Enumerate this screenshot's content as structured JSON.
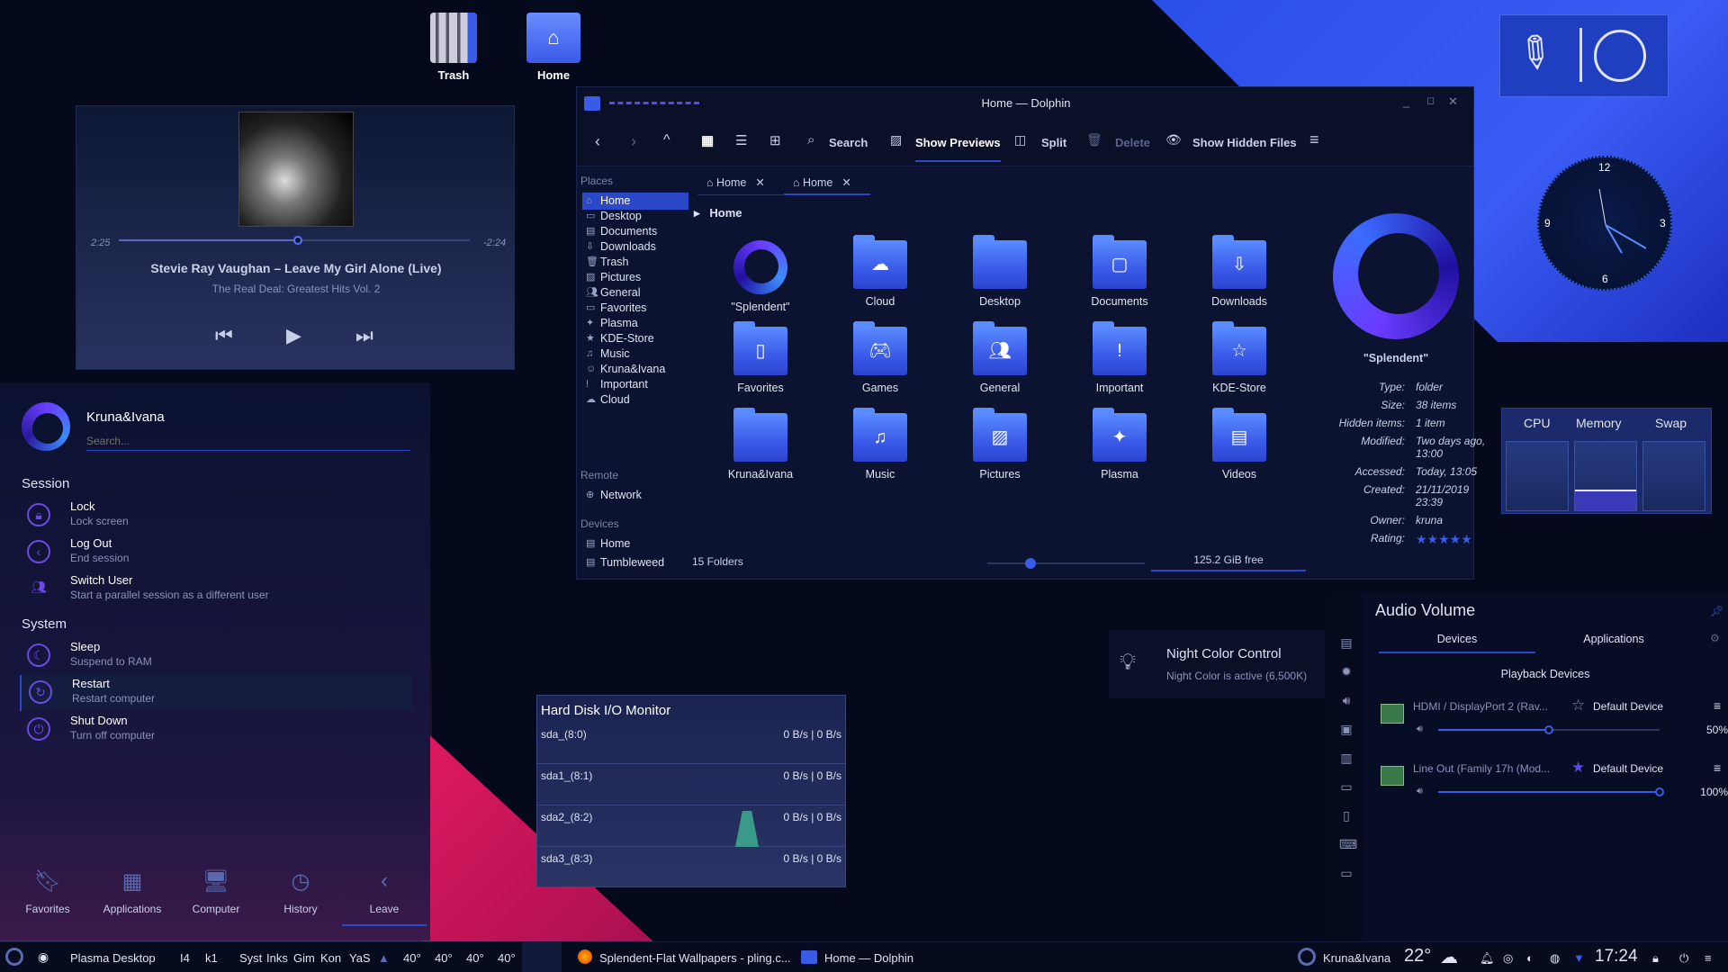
{
  "colors": {
    "accent": "#2a48c8",
    "brand": "#5a73ff",
    "pink": "#e0195f"
  },
  "desktop": {
    "icons": [
      {
        "label": "Trash",
        "icon": "trash-icon"
      },
      {
        "label": "Home",
        "icon": "home-folder-icon"
      }
    ]
  },
  "player": {
    "elapsed": "2:25",
    "remaining": "-2:24",
    "progress": 0.51,
    "title": "Stevie Ray Vaughan – Leave My Girl Alone (Live)",
    "album": "The Real Deal: Greatest Hits Vol. 2"
  },
  "launcher": {
    "user": "Kruna&Ivana",
    "search_placeholder": "Search...",
    "session_title": "Session",
    "session": [
      {
        "t": "Lock",
        "s": "Lock screen"
      },
      {
        "t": "Log Out",
        "s": "End session"
      },
      {
        "t": "Switch User",
        "s": "Start a parallel session as a different user"
      }
    ],
    "system_title": "System",
    "system": [
      {
        "t": "Sleep",
        "s": "Suspend to RAM"
      },
      {
        "t": "Restart",
        "s": "Restart computer"
      },
      {
        "t": "Shut Down",
        "s": "Turn off computer"
      }
    ],
    "tabs": [
      "Favorites",
      "Applications",
      "Computer",
      "History",
      "Leave"
    ]
  },
  "dolphin": {
    "title": "Home — Dolphin",
    "toolbar": {
      "search": "Search",
      "previews": "Show Previews",
      "split": "Split",
      "delete": "Delete",
      "hidden": "Show Hidden Files"
    },
    "tabs": [
      "Home",
      "Home"
    ],
    "breadcrumb": "Home",
    "places_head": "Places",
    "places": [
      "Home",
      "Desktop",
      "Documents",
      "Downloads",
      "Trash",
      "Pictures",
      "General",
      "Favorites",
      "Plasma",
      "KDE-Store",
      "Music",
      "Kruna&Ivana",
      "Important",
      "Cloud"
    ],
    "remote_head": "Remote",
    "remote": [
      "Network"
    ],
    "devices_head": "Devices",
    "devices": [
      "Home",
      "Tumbleweed"
    ],
    "folders": [
      "\"Splendent\"",
      "Cloud",
      "Desktop",
      "Documents",
      "Downloads",
      "Favorites",
      "Games",
      "General",
      "Important",
      "KDE-Store",
      "Kruna&Ivana",
      "Music",
      "Pictures",
      "Plasma",
      "Videos"
    ],
    "status": "15 Folders",
    "free": "125.2 GiB free",
    "info": {
      "name": "\"Splendent\"",
      "rows": [
        [
          "Type:",
          "folder"
        ],
        [
          "Size:",
          "38 items"
        ],
        [
          "Hidden items:",
          "1 item"
        ],
        [
          "Modified:",
          "Two days ago, 13:00"
        ],
        [
          "Accessed:",
          "Today, 13:05"
        ],
        [
          "Created:",
          "21/11/2019 23:39"
        ],
        [
          "Owner:",
          "kruna"
        ],
        [
          "Rating:",
          "★★★★★"
        ]
      ]
    }
  },
  "clock": {
    "n12": "12",
    "n3": "3",
    "n6": "6",
    "n9": "9"
  },
  "cpu": {
    "labels": [
      "CPU",
      "Memory",
      "Swap"
    ],
    "memory_used": 0.3
  },
  "night": {
    "title": "Night Color Control",
    "sub": "Night Color is active (6,500K)"
  },
  "hdd": {
    "title": "Hard Disk I/O Monitor",
    "rows": [
      {
        "n": "sda_(8:0)",
        "v": "0 B/s | 0 B/s"
      },
      {
        "n": "sda1_(8:1)",
        "v": "0 B/s | 0 B/s"
      },
      {
        "n": "sda2_(8:2)",
        "v": "0 B/s | 0 B/s"
      },
      {
        "n": "sda3_(8:3)",
        "v": "0 B/s | 0 B/s"
      }
    ]
  },
  "audio": {
    "title": "Audio Volume",
    "tab_devices": "Devices",
    "tab_apps": "Applications",
    "section": "Playback Devices",
    "devices": [
      {
        "name": "HDMI / DisplayPort 2 (Rav...",
        "default": "Default Device",
        "vol": "50%",
        "level": 0.5
      },
      {
        "name": "Line Out (Family 17h (Mod...",
        "default": "Default Device",
        "vol": "100%",
        "level": 1.0
      }
    ]
  },
  "taskbar": {
    "desktop": "Plasma Desktop",
    "pager": [
      "I4",
      "k1"
    ],
    "items": [
      "Syst",
      "Inks",
      "Gim",
      "Kon",
      "YaS"
    ],
    "temps": [
      "40°",
      "40°",
      "40°",
      "40°"
    ],
    "task1": "Splendent-Flat Wallpapers - pling.c...",
    "task2": "Home — Dolphin",
    "user": "Kruna&Ivana",
    "temp": "22°",
    "time": "17:24"
  }
}
